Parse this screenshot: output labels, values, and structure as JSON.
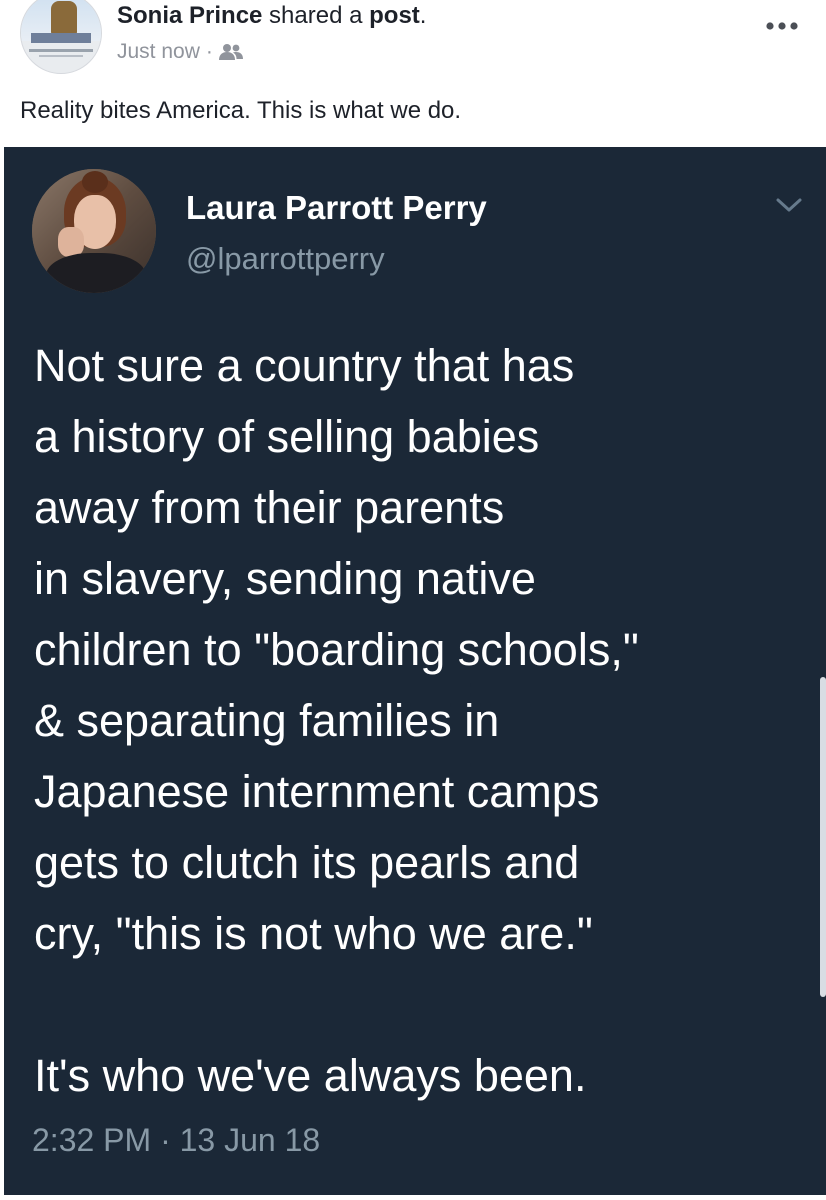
{
  "share_header": {
    "sharer_name": "Sonia Prince",
    "action_text": " shared a ",
    "object_text": "post",
    "period": ".",
    "timestamp": "Just now",
    "separator": "·",
    "audience_icon": "friends-icon",
    "menu_icon": "more-icon"
  },
  "post_text": "Reality bites America. This is what we do.",
  "tweet": {
    "author_name": "Laura Parrott Perry",
    "handle": "@lparrottperry",
    "menu_icon": "chevron-down-icon",
    "body_lines": [
      "Not sure a country that has",
      "a history of selling babies",
      "away from their parents",
      "in slavery, sending native",
      "children to \"boarding schools,\"",
      "& separating families in",
      "Japanese internment camps",
      "gets to clutch its pearls and",
      "cry, \"this is not who we are.\""
    ],
    "closing_line": "It's who we've always been.",
    "timestamp": "2:32 PM · 13 Jun 18"
  },
  "colors": {
    "tweet_background": "#1b2837",
    "tweet_secondary_text": "#8899a6",
    "fb_secondary_text": "#90949c",
    "fb_primary_text": "#1d2129"
  }
}
